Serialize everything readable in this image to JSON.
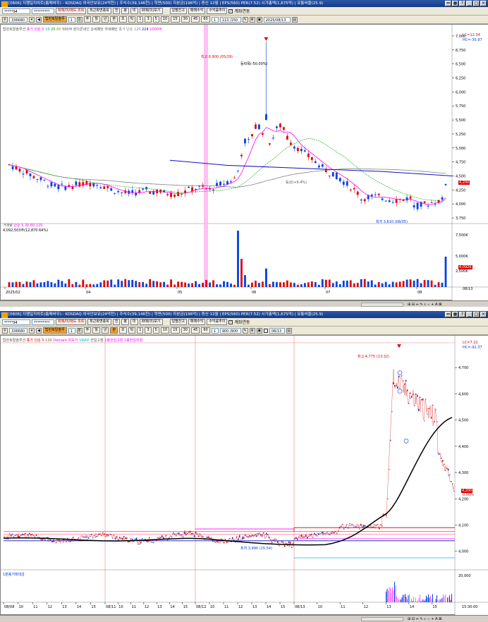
{
  "window1": {
    "title": "[0606] 지행일자차트(틈매바우) - KOSDAQ 외국인보유(24억천) | 주식수(39,146천) | 혁면(500) 자본금(196억) | 증신 12월 | EPS(560) PER(7.52) 시가총액(1,675억) | 유통비율(25.9)",
    "toolbar_row1": {
      "account_select": "*****94",
      "password": "*********",
      "buy_sell_label": "화매/미/매도 조회",
      "recent_label": "최근화면종목",
      "period_buttons": [
        "전",
        "봉",
        "미"
      ],
      "realtime_label": "화매(미)보기",
      "daily_label": "일별잔고",
      "trade_label": "매매수익",
      "profit_label": "수익률추이",
      "continuous_label": "계좌연동"
    },
    "toolbar_row2": {
      "code": "336680",
      "stock_name": "탑런토탈솔루",
      "count": "1",
      "period_units": [
        "주",
        "월",
        "년",
        "분",
        "초",
        "틱"
      ],
      "intervals": [
        "1",
        "3",
        "5",
        "10",
        "15",
        "30",
        "45",
        "60"
      ],
      "input_value": "1",
      "range_text": "113 /150",
      "date": "2025/08/13"
    },
    "legend": {
      "name": "탑런토탈솔루션",
      "ma_label": "종가 단순 5",
      "ma10": "10",
      "ma20": "20",
      "ma60": "60",
      "extra": "500억 원다른네인 강세패턴 약세패턴",
      "ma120": "종가 단순 120",
      "ma224": "224",
      "ma_long": "1000억"
    },
    "annotations": {
      "high": "최고 6,900 (05/29)",
      "pct": "등락폭(-50.00%)",
      "low": "최저 3,810 (08/05)",
      "mid": "등상(+9.4%)",
      "lc": "LC=12.34",
      "hc": "HC=-30.97",
      "volume_legend": "거래량",
      "volume_ma": "단순 5 20 60 120",
      "volume_value": "4,092,503주(12,870.64%)"
    },
    "price_ticks": [
      "7,000",
      "6,750",
      "6,500",
      "6,250",
      "6,000",
      "5,750",
      "5,500",
      "5,250",
      "5,000",
      "4,750",
      "4,500",
      "4,250",
      "4,000",
      "3,750"
    ],
    "current_price": "4,200",
    "volume_ticks": [
      "7,500K",
      "5,000K",
      "2,500K"
    ],
    "volume_current": "4,092K",
    "x_labels": [
      "2025/02",
      "04",
      "05",
      "06",
      "07",
      "08"
    ],
    "last_date": "08/13"
  },
  "window2": {
    "title": "[0606] 지행일자차트(틈매바우) - KOSDAQ 외국인보유(24억천) | 주식수(39,146천) | 혁면(500) 자본금(196억) | 증신 12월 | EPS(560) PER(7.52) 시가총액(1,675억) | 유통비율(25.9)",
    "toolbar_row1": {
      "account_select": "*****94",
      "password": "*********",
      "buy_sell_label": "화매/미/매도 조회",
      "recent_label": "최근화면종목",
      "period_buttons": [
        "전",
        "봉",
        "미"
      ],
      "realtime_label": "화매(미)보기",
      "daily_label": "일별잔고",
      "trade_label": "매매수익",
      "profit_label": "수익률추이",
      "continuous_label": "계좌연동"
    },
    "toolbar_row2": {
      "code": "336680",
      "stock_name": "탑런토탈솔루",
      "count": "1",
      "period_units": [
        "주",
        "월",
        "년",
        "분",
        "초",
        "틱"
      ],
      "intervals": [
        "1",
        "3",
        "5",
        "10",
        "15",
        "30",
        "45",
        "60"
      ],
      "input_value": "1",
      "range_text": "900 /900",
      "date": "08/13"
    },
    "legend": {
      "name": "탑런토탈솔루션",
      "ma_label": "종가 단순 5",
      "ma120": "120",
      "demark": "Demark 피보가",
      "vwap": "VWAP",
      "prev_high": "전일고점",
      "prev_close": "1봉전일고점",
      "prev_low": "1봉전일저점"
    },
    "annotations": {
      "high": "최고 4,775 (13:32)",
      "low": "최저 3,990 (15:54)",
      "lc": "LC=7.22",
      "hc": "HC=-92.37",
      "volume_legend": "1분봉거래대금"
    },
    "price_ticks": [
      "4,700",
      "4,600",
      "4,500",
      "4,400",
      "4,300",
      "4,200",
      "4,100",
      "4,000"
    ],
    "current_price": "4,200",
    "current_pct": "0.00%",
    "volume_ticks": [
      "20,000"
    ],
    "x_labels": [
      "08/08",
      "10",
      "11",
      "12",
      "13",
      "14",
      "15",
      "08/11",
      "10",
      "11",
      "12",
      "13",
      "14",
      "15",
      "08/12",
      "10",
      "11",
      "12",
      "13",
      "14",
      "15",
      "08/13",
      "10",
      "11",
      "12",
      "13",
      "14",
      "15"
    ],
    "last_time": "15:30:00"
  },
  "colors": {
    "up": "#e00000",
    "down": "#0040e0",
    "ma5": "#ff00ff",
    "ma20": "#00a000",
    "ma120": "#808080",
    "ma224": "#1010c0",
    "highlight": "#ffb0f0",
    "vwap": "#000000",
    "cyan": "#00c0d0"
  }
}
